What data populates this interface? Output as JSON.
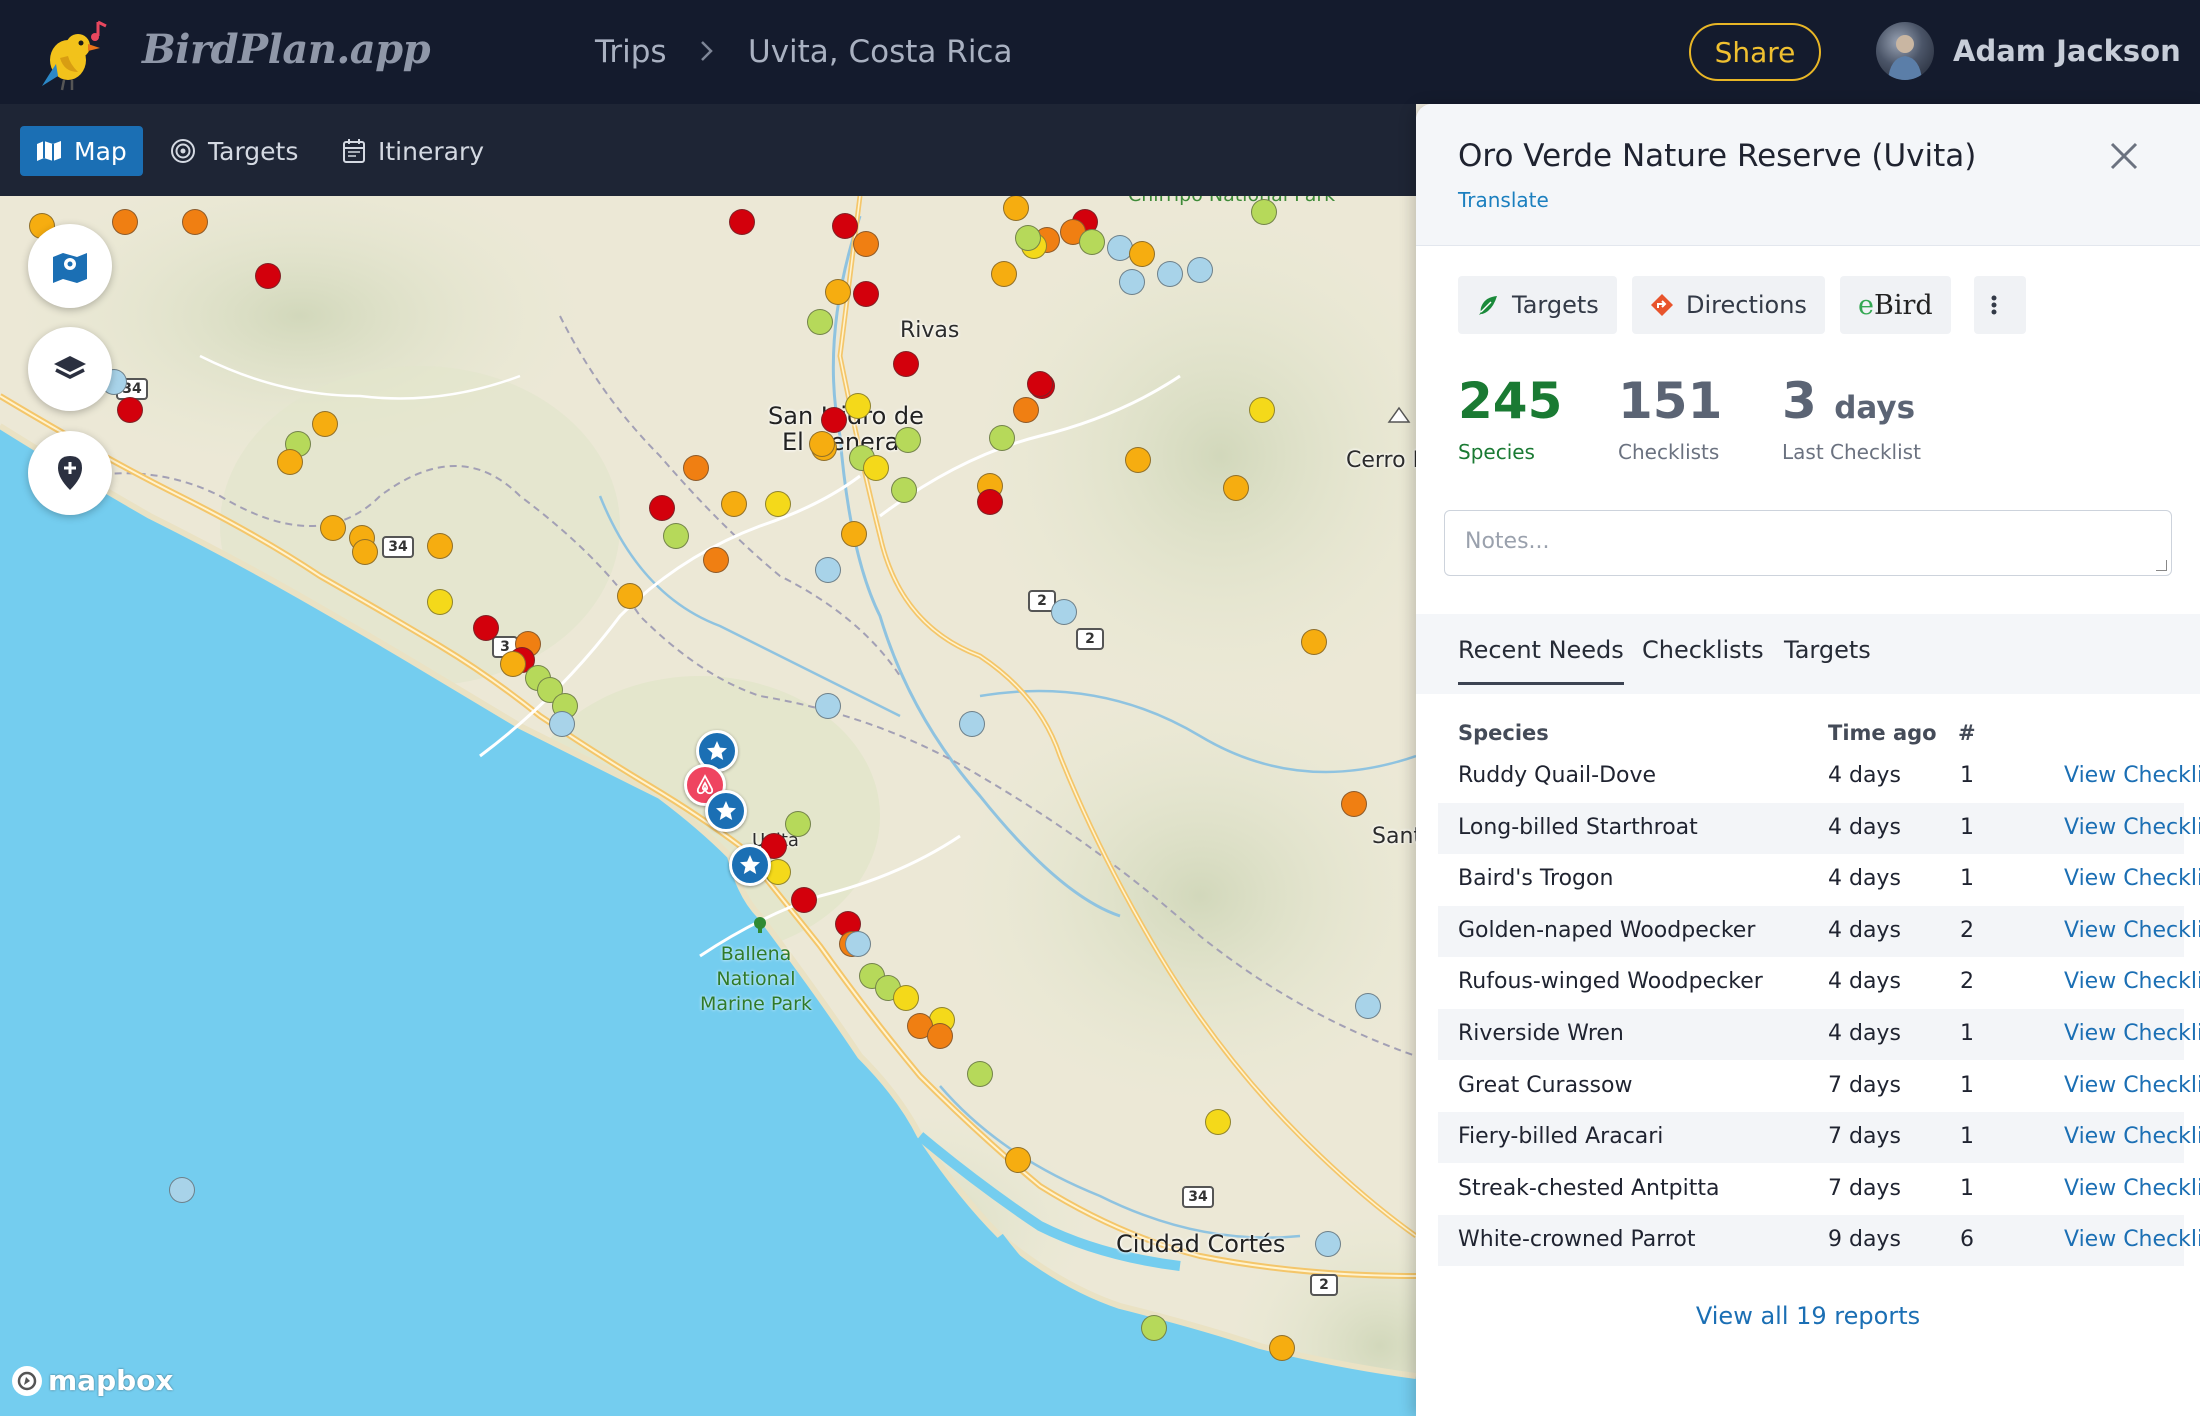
{
  "header": {
    "logo_text": "BirdPlan.app",
    "breadcrumb_trips": "Trips",
    "breadcrumb_place": "Uvita, Costa Rica",
    "share_label": "Share",
    "user_name": "Adam Jackson"
  },
  "nav": {
    "map": "Map",
    "targets": "Targets",
    "itinerary": "Itinerary",
    "active": "Map"
  },
  "map": {
    "labels": {
      "rivas": "Rivas",
      "san_isidro": "San Isidro de",
      "el_general": "El General",
      "cerro": "Cerro Er",
      "santa": "Santa",
      "ciudad_cortes": "Ciudad Cortés",
      "uvita": "Uvita",
      "chirripo": "Chirripo National Park",
      "ballena_1": "Ballena National",
      "ballena_2": "Marine Park"
    },
    "route_shields": {
      "s34_a": "34",
      "s34_b": "34",
      "s34_c": "3",
      "s34_d": "34",
      "s2_a": "2",
      "s2_b": "2",
      "s2_c": "2"
    },
    "attribution": "mapbox",
    "hotspot_colors": {
      "red": "#d3000c",
      "orange": "#f07f12",
      "amber": "#f6ad10",
      "yellow": "#f4d91a",
      "lime": "#b6d95a",
      "blue": "#a8d3e9"
    }
  },
  "panel": {
    "title": "Oro Verde Nature Reserve (Uvita)",
    "translate": "Translate",
    "actions": {
      "targets": "Targets",
      "directions": "Directions",
      "ebird_e": "e",
      "ebird_rest": "Bird"
    },
    "stats": {
      "species_value": "245",
      "species_label": "Species",
      "checklists_value": "151",
      "checklists_label": "Checklists",
      "last_value": "3",
      "last_unit": "days",
      "last_label": "Last Checklist"
    },
    "species_color": "#1a7a33",
    "notes_placeholder": "Notes...",
    "tabs": [
      "Recent Needs",
      "Checklists",
      "Targets"
    ],
    "active_tab": "Recent Needs",
    "table": {
      "headers": [
        "Species",
        "Time ago",
        "#"
      ],
      "rows": [
        {
          "species": "Ruddy Quail-Dove",
          "time": "4 days",
          "count": "1",
          "link": "View Checklist"
        },
        {
          "species": "Long-billed Starthroat",
          "time": "4 days",
          "count": "1",
          "link": "View Checklist"
        },
        {
          "species": "Baird's Trogon",
          "time": "4 days",
          "count": "1",
          "link": "View Checklist"
        },
        {
          "species": "Golden-naped Woodpecker",
          "time": "4 days",
          "count": "2",
          "link": "View Checklist"
        },
        {
          "species": "Rufous-winged Woodpecker",
          "time": "4 days",
          "count": "2",
          "link": "View Checklist"
        },
        {
          "species": "Riverside Wren",
          "time": "4 days",
          "count": "1",
          "link": "View Checklist"
        },
        {
          "species": "Great Curassow",
          "time": "7 days",
          "count": "1",
          "link": "View Checklist"
        },
        {
          "species": "Fiery-billed Aracari",
          "time": "7 days",
          "count": "1",
          "link": "View Checklist"
        },
        {
          "species": "Streak-chested Antpitta",
          "time": "7 days",
          "count": "1",
          "link": "View Checklist"
        },
        {
          "species": "White-crowned Parrot",
          "time": "9 days",
          "count": "6",
          "link": "View Checklist"
        }
      ]
    },
    "view_all": "View all 19 reports"
  }
}
